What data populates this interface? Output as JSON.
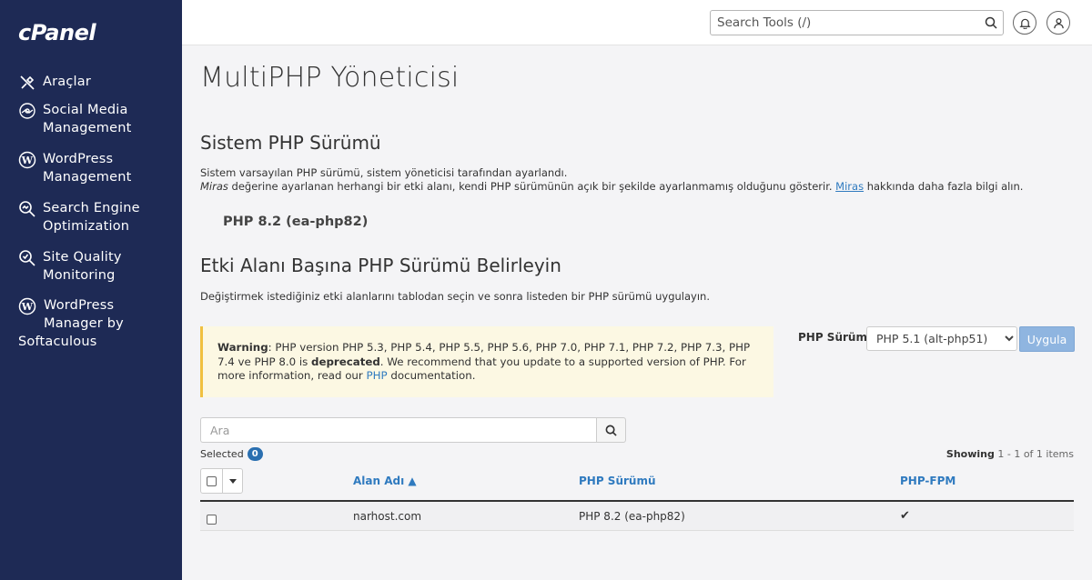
{
  "app": {
    "logo": "cPanel"
  },
  "sidebar": {
    "items": [
      {
        "label": "Araçlar",
        "icon": "tools-icon"
      },
      {
        "label_lines": [
          "Social Media",
          "Management"
        ],
        "icon": "social-media-icon"
      },
      {
        "label_lines": [
          "WordPress",
          "Management"
        ],
        "icon": "wordpress-icon"
      },
      {
        "label_lines": [
          "Search Engine",
          "Optimization"
        ],
        "icon": "seo-icon"
      },
      {
        "label_lines": [
          "Site Quality",
          "Monitoring"
        ],
        "icon": "site-quality-icon"
      },
      {
        "label_lines": [
          "WordPress",
          "Manager by",
          "Softaculous"
        ],
        "icon": "wordpress-icon"
      }
    ]
  },
  "topbar": {
    "search_placeholder": "Search Tools (/)"
  },
  "page": {
    "title": "MultiPHP Yöneticisi"
  },
  "system_php": {
    "heading": "Sistem PHP Sürümü",
    "desc1": "Sistem varsayılan PHP sürümü, sistem yöneticisi tarafından ayarlandı.",
    "desc2_italic": "Miras",
    "desc2_mid": " değerine ayarlanan herhangi bir etki alanı, kendi PHP sürümünün açık bir şekilde ayarlanmamış olduğunu gösterir. ",
    "desc2_link": "Miras",
    "desc2_end": " hakkında daha fazla bilgi alın.",
    "version": "PHP 8.2 (ea-php82)"
  },
  "per_domain": {
    "heading": "Etki Alanı Başına PHP Sürümü Belirleyin",
    "desc": "Değiştirmek istediğiniz etki alanlarını tablodan seçin ve sonra listeden bir PHP sürümü uygulayın."
  },
  "warning": {
    "strong": "Warning",
    "text1": ": PHP version PHP 5.3, PHP 5.4, PHP 5.5, PHP 5.6, PHP 7.0, PHP 7.1, PHP 7.2, PHP 7.3, PHP 7.4 ve PHP 8.0 is ",
    "deprecated": "deprecated",
    "text2": ". We recommend that you update to a supported version of PHP. For more information, read our ",
    "link": "PHP",
    "text3": " documentation."
  },
  "php_version_select": {
    "label": "PHP Sürümü",
    "selected": "PHP 5.1 (alt-php51)",
    "apply_label": "Uygula"
  },
  "domain_search": {
    "placeholder": "Ara"
  },
  "table": {
    "selected_label": "Selected",
    "selected_count": "0",
    "showing_label": "Showing",
    "showing_range": "1 - 1 of 1 items",
    "columns": {
      "domain": "Alan Adı ▲",
      "php_version": "PHP Sürümü",
      "php_fpm": "PHP-FPM"
    },
    "rows": [
      {
        "domain": "narhost.com",
        "php_version": "PHP 8.2 (ea-php82)",
        "php_fpm": "✔"
      }
    ]
  }
}
